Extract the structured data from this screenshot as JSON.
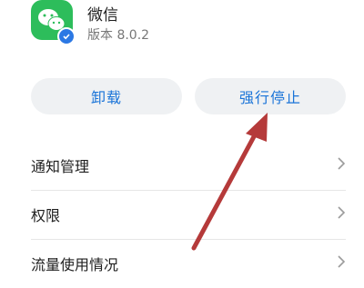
{
  "app": {
    "name": "微信",
    "version": "版本 8.0.2",
    "icon": "wechat-icon",
    "badge_icon": "verified-check-icon"
  },
  "buttons": {
    "uninstall": "卸载",
    "force_stop": "强行停止"
  },
  "menu": {
    "items": [
      {
        "label": "通知管理",
        "icon": "chevron-right-icon"
      },
      {
        "label": "权限",
        "icon": "chevron-right-icon"
      },
      {
        "label": "流量使用情况",
        "icon": "chevron-right-icon"
      }
    ]
  },
  "colors": {
    "accent": "#1a74d8",
    "wechat_green": "#2dbd5b",
    "annotation_arrow": "#b53a3a",
    "button_bg": "#eff1f3"
  },
  "annotation": {
    "icon": "pointer-arrow-icon"
  }
}
